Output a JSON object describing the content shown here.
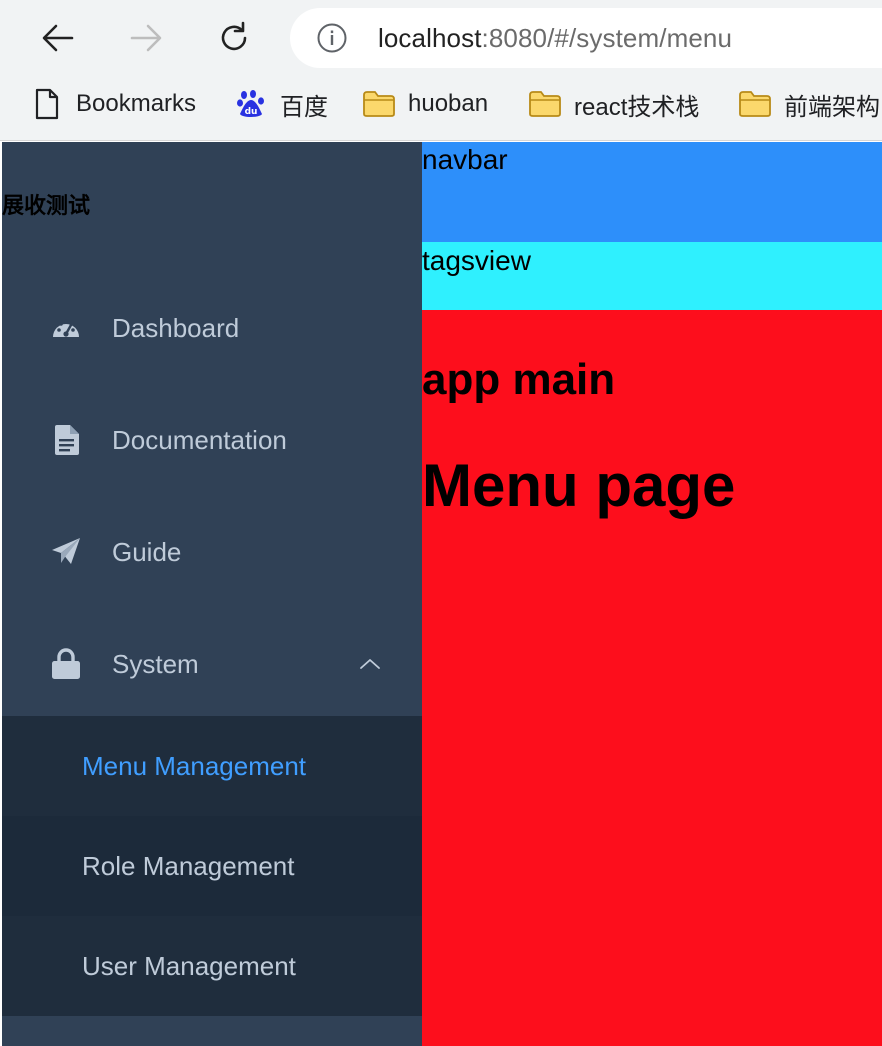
{
  "browser": {
    "url_host": "localhost",
    "url_rest": ":8080/#/system/menu",
    "bookmarks": [
      {
        "label": "Bookmarks",
        "icon": "page-icon"
      },
      {
        "label": "百度",
        "icon": "baidu-icon"
      },
      {
        "label": "huoban",
        "icon": "folder-icon"
      },
      {
        "label": "react技术栈",
        "icon": "folder-icon"
      },
      {
        "label": "前端架构",
        "icon": "folder-icon"
      }
    ]
  },
  "sidebar": {
    "title": "展收测试",
    "items": [
      {
        "label": "Dashboard",
        "icon": "dashboard-icon"
      },
      {
        "label": "Documentation",
        "icon": "document-icon"
      },
      {
        "label": "Guide",
        "icon": "paper-plane-icon"
      },
      {
        "label": "System",
        "icon": "lock-icon",
        "expanded": true
      }
    ],
    "submenu": [
      {
        "label": "Menu Management",
        "active": true
      },
      {
        "label": "Role Management"
      },
      {
        "label": "User Management"
      }
    ]
  },
  "main": {
    "navbar": "navbar",
    "tagsview": "tagsview",
    "app_main": "app main",
    "page_title": "Menu page"
  },
  "colors": {
    "sidebar_bg": "#304156",
    "submenu_bg": "#1f2d3d",
    "menu_text": "#bfcbd9",
    "active_text": "#409eff",
    "navbar_bg": "#2d8ffa",
    "tagsview_bg": "#2ff0fe",
    "app_main_bg": "#fd0e1c"
  }
}
